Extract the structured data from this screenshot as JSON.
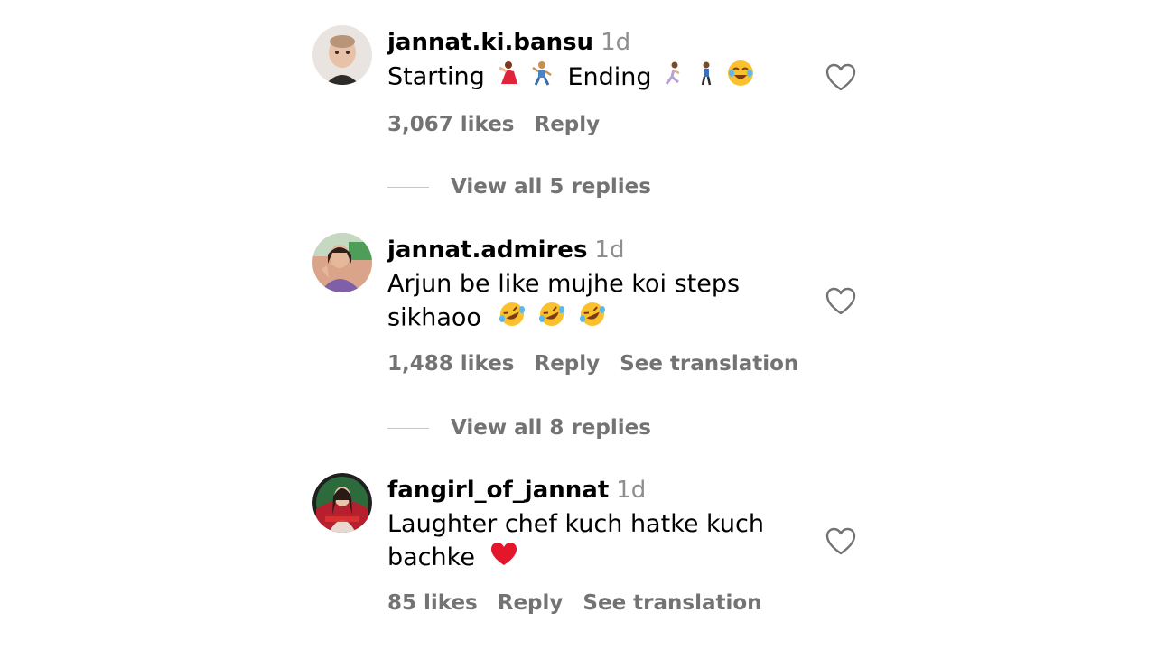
{
  "comments": [
    {
      "username": "jannat.ki.bansu",
      "time": "1d",
      "text_parts": [
        "Starting",
        "Ending"
      ],
      "likes": "3,067 likes",
      "reply": "Reply",
      "view_replies": "View all 5 replies"
    },
    {
      "username": "jannat.admires",
      "time": "1d",
      "text_line1": "Arjun be like mujhe koi steps",
      "text_line2": "sikhaoo",
      "likes": "1,488 likes",
      "reply": "Reply",
      "see_translation": "See translation",
      "view_replies": "View all 8 replies"
    },
    {
      "username": "fangirl_of_jannat",
      "time": "1d",
      "text_line1": "Laughter chef kuch hatke kuch",
      "text_line2": "bachke",
      "likes": "85 likes",
      "reply": "Reply",
      "see_translation": "See translation"
    }
  ],
  "colors": {
    "secondary_text": "#737373",
    "timestamp": "#8e8e8e",
    "divider": "#c7c7c7"
  },
  "icons": {
    "like": "heart-outline-icon",
    "emoji_dancer": "dancer-emoji",
    "emoji_man_dancing": "man-dancing-emoji",
    "emoji_running": "running-emoji",
    "emoji_walking": "walking-emoji",
    "emoji_joy": "face-with-tears-of-joy-emoji",
    "emoji_rofl": "rolling-on-floor-laughing-emoji",
    "emoji_heart": "red-heart-emoji"
  }
}
